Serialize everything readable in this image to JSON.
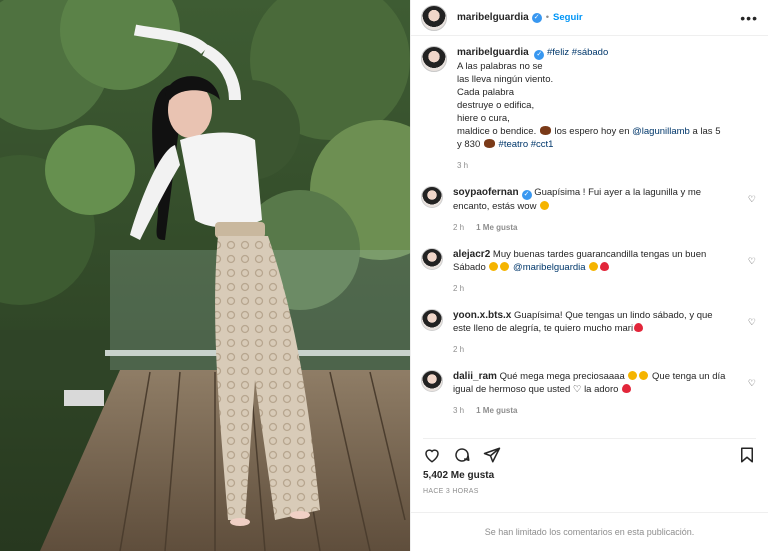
{
  "post": {
    "author": "maribelguardia",
    "follow_label": "Seguir",
    "caption_lines": [
      "A las palabras no se",
      "las lleva ningún viento.",
      "Cada palabra",
      "destruye o edifica,",
      "hiere o cura,"
    ],
    "hashtags_inline": "#feliz #sábado",
    "line_bendice": "maldice o bendice.",
    "line_espero": "los espero hoy en",
    "mention": "@lagunillamb",
    "line_time": "a las 5",
    "line_time2": "y 830",
    "hashtags_end": "#teatro #cct1",
    "caption_time": "3 h"
  },
  "comments": [
    {
      "user": "soypaofernan",
      "verified": true,
      "text": "Guapísima ! Fui ayer a la lagunilla y me encanto, estás wow",
      "time": "2 h",
      "likes": "1 Me gusta"
    },
    {
      "user": "alejacr2",
      "text_a": "Muy buenas tardes guarancandilla tengas un buen Sábado",
      "mention": "@maribelguardia",
      "time": "2 h",
      "likes": ""
    },
    {
      "user": "yoon.x.bts.x",
      "text": "Guapísima! Que tengas un lindo sábado, y que este lleno de alegría, te quiero mucho mari",
      "time": "2 h",
      "likes": ""
    },
    {
      "user": "dalii_ram",
      "text_a": "Qué mega mega preciosaaaa",
      "text_b": "Que tenga un día igual de hermoso que usted",
      "text_c": "la adoro",
      "time": "3 h",
      "likes": "1 Me gusta"
    }
  ],
  "likes_count": "5,402 Me gusta",
  "posted_ago": "HACE 3 HORAS",
  "comments_disabled": "Se han limitado los comentarios en esta publicación.",
  "colors": {
    "link": "#0095f6",
    "tag": "#00376b",
    "muted": "#8e8e8e",
    "verified": "#3897f0"
  },
  "icons": [
    "heart-icon",
    "comment-icon",
    "share-icon",
    "save-icon",
    "more-icon",
    "verified-icon"
  ]
}
